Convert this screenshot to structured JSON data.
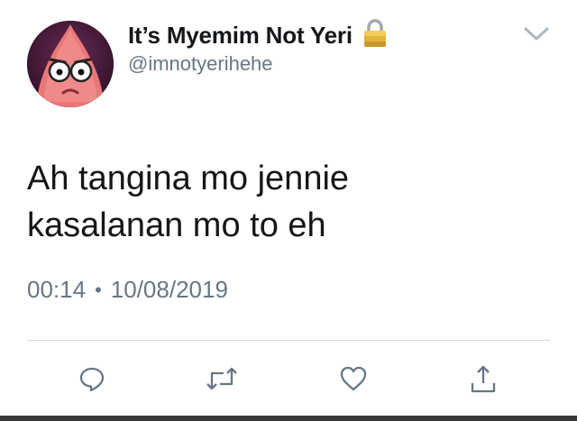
{
  "tweet": {
    "display_name": "It’s Myemim Not Yeri",
    "username": "@imnotyerihehe",
    "text_lines": [
      "Ah tangina mo jennie",
      "kasalanan mo to eh"
    ],
    "time": "00:14",
    "separator": "•",
    "date": "10/08/2019",
    "protected_icon": "lock-icon",
    "colors": {
      "primary_text": "#14171a",
      "secondary_text": "#657786",
      "icon_gray": "#657786",
      "divider": "#d3dbe1"
    }
  },
  "actions": [
    "reply-icon",
    "retweet-icon",
    "like-icon",
    "share-icon"
  ]
}
